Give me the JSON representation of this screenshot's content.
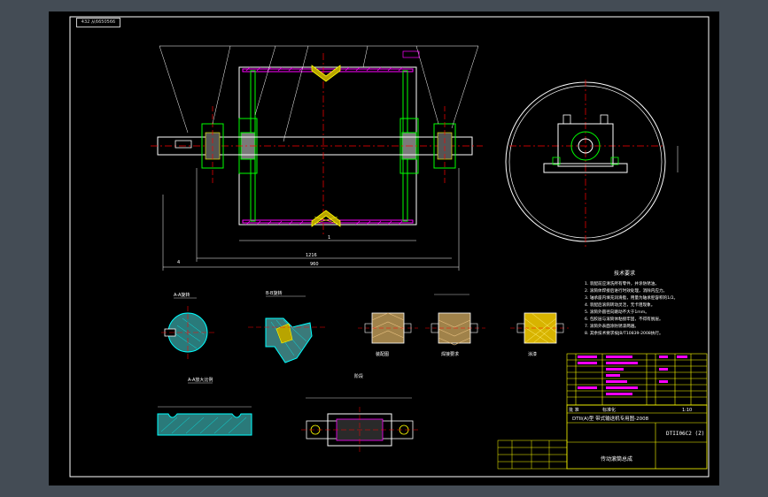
{
  "drawing": {
    "tag": "432 从6650566",
    "main_dimensions": [
      "4",
      "960",
      "1216",
      "1"
    ],
    "section_labels": [
      "A-A旋转",
      "B-B旋转",
      "A-A放大比例",
      "阶段"
    ],
    "view_labels": [
      "装配图",
      "焊接要求",
      "涂漆"
    ],
    "tech_req_title": "技术要求",
    "tech_req_lines": [
      "1. 装配前应清洗所有零件，并涂防锈油。",
      "2. 滚筒体焊接后进行时效处理，消除内应力。",
      "3. 轴承座内填充润滑脂，用量为轴承腔容积的1/2。",
      "4. 装配后滚筒转动灵活，无卡阻现象。",
      "5. 滚筒外圆径向跳动不大于1mm。",
      "6. 包胶层与滚筒体粘接牢固，不得有脱层。",
      "7. 滚筒外表面涂防锈漆两遍。",
      "8. 其余技术要求按JB/T10839-2008执行。"
    ],
    "title_block": {
      "label_1": "批 准",
      "label_2": "标准化",
      "scale": "1:10",
      "project": "DTII(A)型 带式输送机专用图-2008",
      "drawing_no": "DTII06C2 (Z)",
      "name": "传动滚筒总成"
    }
  }
}
